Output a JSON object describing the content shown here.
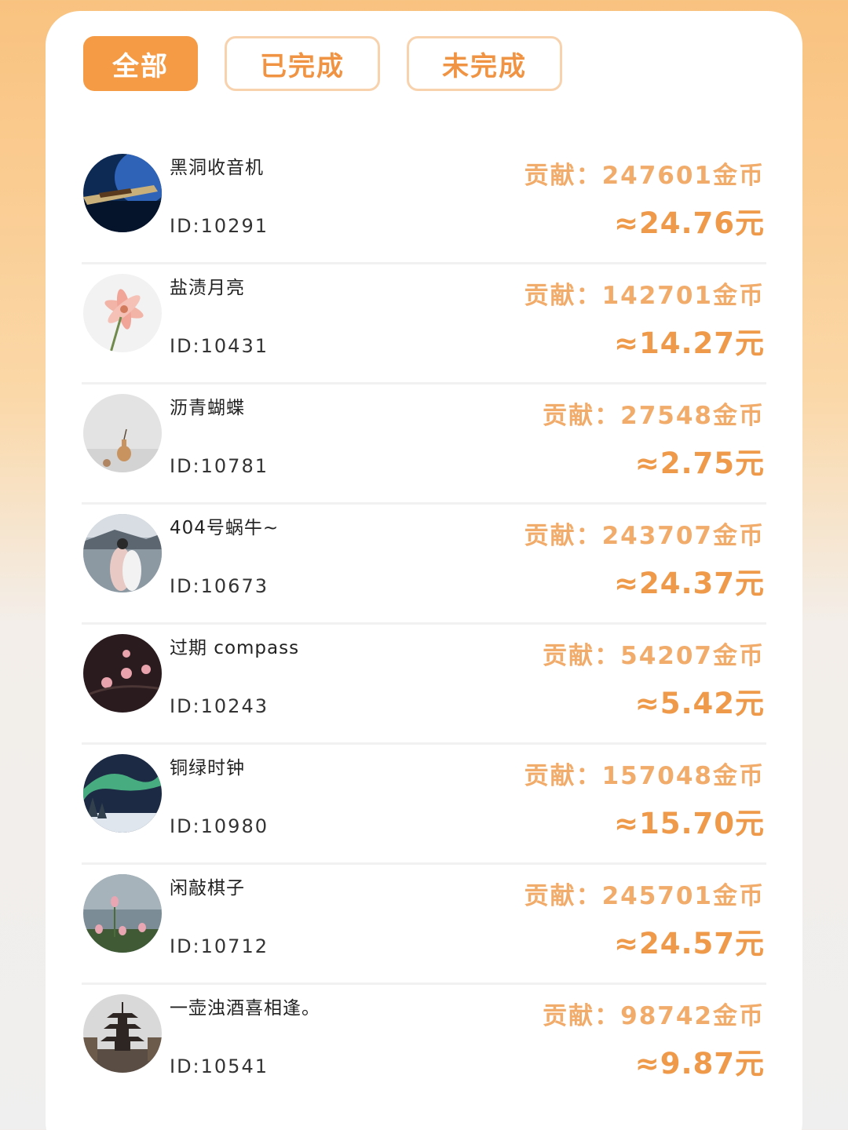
{
  "tabs": [
    {
      "label": "全部",
      "active": true
    },
    {
      "label": "已完成",
      "active": false
    },
    {
      "label": "未完成",
      "active": false
    }
  ],
  "colors": {
    "accent": "#f59b45",
    "contribution_text": "#f1ab6a",
    "amount_text": "#ee9a4a",
    "tab_border": "#f8d2ad"
  },
  "contributors": [
    {
      "name": "黑洞收音机",
      "id": "ID:10291",
      "contribution": "贡献：247601金币",
      "amount": "≈24.76元",
      "avatar": "guitar-photo"
    },
    {
      "name": "盐渍月亮",
      "id": "ID:10431",
      "contribution": "贡献：142701金币",
      "amount": "≈14.27元",
      "avatar": "lily-photo"
    },
    {
      "name": "沥青蝴蝶",
      "id": "ID:10781",
      "contribution": "贡献：27548金币",
      "amount": "≈2.75元",
      "avatar": "vase-photo"
    },
    {
      "name": "404号蜗牛~",
      "id": "ID:10673",
      "contribution": "贡献：243707金币",
      "amount": "≈24.37元",
      "avatar": "couple-photo"
    },
    {
      "name": "过期 compass",
      "id": "ID:10243",
      "contribution": "贡献：54207金币",
      "amount": "≈5.42元",
      "avatar": "blossom-photo"
    },
    {
      "name": "铜绿时钟",
      "id": "ID:10980",
      "contribution": "贡献：157048金币",
      "amount": "≈15.70元",
      "avatar": "aurora-photo"
    },
    {
      "name": "闲敲棋子",
      "id": "ID:10712",
      "contribution": "贡献：245701金币",
      "amount": "≈24.57元",
      "avatar": "tulip-photo"
    },
    {
      "name": "一壶浊酒喜相逢。",
      "id": "ID:10541",
      "contribution": "贡献：98742金币",
      "amount": "≈9.87元",
      "avatar": "pagoda-photo"
    }
  ]
}
